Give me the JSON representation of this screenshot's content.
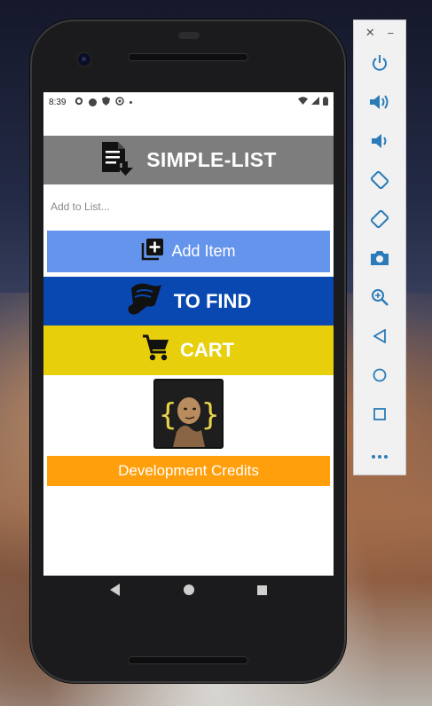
{
  "status_bar": {
    "time": "8:39"
  },
  "app": {
    "header_title": "SIMPLE-LIST",
    "input_placeholder": "Add to List...",
    "add_item_label": "Add Item",
    "to_find_label": "TO FIND",
    "cart_label": "CART",
    "credits_label": "Development Credits"
  },
  "colors": {
    "header_bg": "#7d7d7d",
    "add_item_bg": "#6494ec",
    "to_find_bg": "#0948b0",
    "cart_bg": "#e7cf0c",
    "credits_bg": "#ff9f0c",
    "emulator_icon": "#2a7bb8"
  },
  "emulator_panel": {
    "window_controls": [
      "close-icon",
      "minimize-icon"
    ],
    "buttons": [
      "power-icon",
      "volume-up-icon",
      "volume-down-icon",
      "rotate-left-icon",
      "rotate-right-icon",
      "camera-icon",
      "zoom-icon",
      "back-icon",
      "home-icon",
      "overview-icon",
      "more-icon"
    ]
  }
}
